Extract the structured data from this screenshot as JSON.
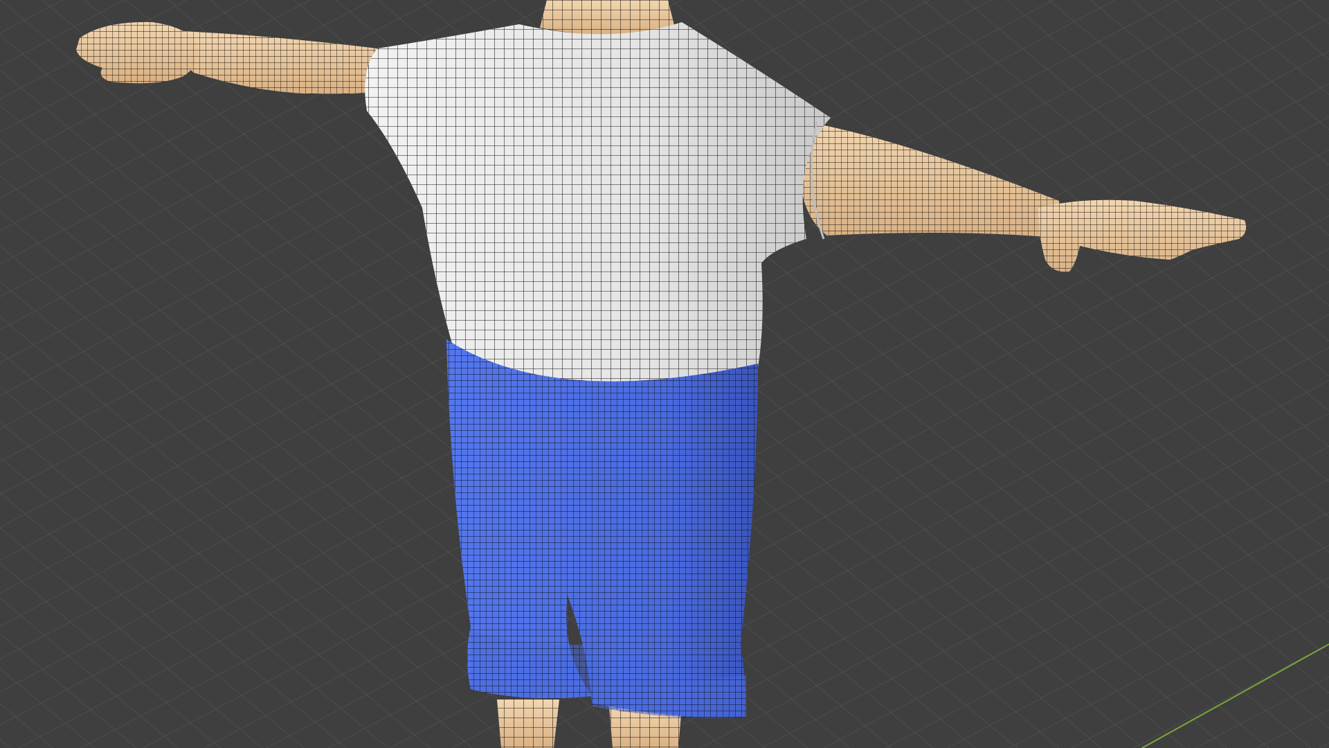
{
  "viewport": {
    "view": "3D Viewport",
    "shading": "solid",
    "overlay": "wireframe",
    "grid": true,
    "axis_line": "y-axis"
  },
  "colors": {
    "background": "#3f3f3f",
    "grid_line": "#565656",
    "skin": "#e9c79b",
    "shirt": "#e6e6e6",
    "shorts": "#4a6be0",
    "wire": "#111111",
    "axis_y": "#7aa83a"
  },
  "model": {
    "parts": [
      {
        "name": "neck",
        "material": "skin"
      },
      {
        "name": "left-arm",
        "material": "skin"
      },
      {
        "name": "right-arm",
        "material": "skin"
      },
      {
        "name": "left-hand",
        "material": "skin"
      },
      {
        "name": "right-hand",
        "material": "skin"
      },
      {
        "name": "shirt",
        "material": "shirt"
      },
      {
        "name": "shorts",
        "material": "shorts"
      },
      {
        "name": "left-leg",
        "material": "skin"
      },
      {
        "name": "right-leg",
        "material": "skin"
      }
    ]
  }
}
